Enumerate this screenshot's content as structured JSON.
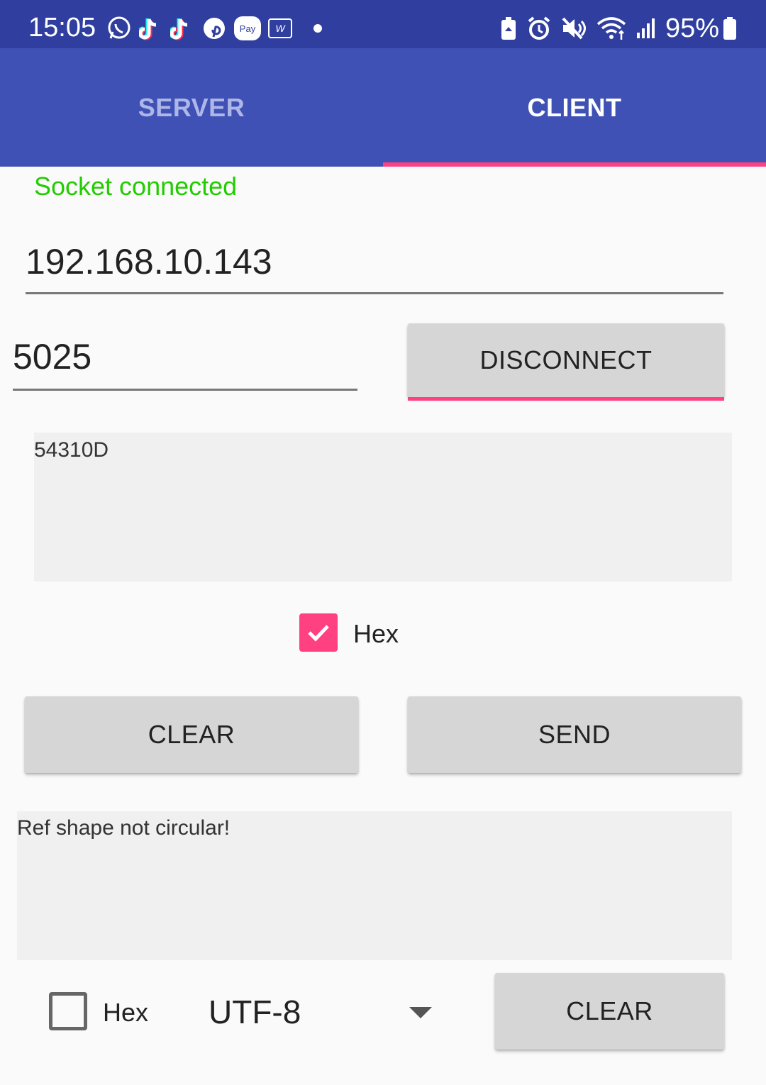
{
  "status_bar": {
    "time": "15:05",
    "battery": "95%",
    "left_icons": [
      "whatsapp-icon",
      "tiktok-icon",
      "tiktok-icon",
      "pinterest-icon",
      "pay-icon",
      "w-app-icon",
      "dot-icon"
    ],
    "pay_label": "Pay",
    "w_label": "W",
    "right_icons": [
      "battery-saver-icon",
      "alarm-icon",
      "mute-icon",
      "wifi-icon",
      "signal-icon",
      "battery-icon"
    ]
  },
  "tabs": [
    {
      "label": "SERVER",
      "active": false
    },
    {
      "label": "CLIENT",
      "active": true
    }
  ],
  "connection": {
    "status": "Socket connected",
    "status_color": "#22cc00",
    "ip": "192.168.10.143",
    "port": "5025",
    "disconnect_label": "DISCONNECT"
  },
  "send": {
    "text": "54310D",
    "hex_label": "Hex",
    "hex_checked": true,
    "clear_label": "CLEAR",
    "send_label": "SEND"
  },
  "receive": {
    "text": "Ref shape not circular!",
    "hex_label": "Hex",
    "hex_checked": false,
    "encoding": "UTF-8",
    "clear_label": "CLEAR"
  },
  "colors": {
    "status_bar": "#303f9f",
    "app_bar": "#3f51b5",
    "accent": "#ff4081"
  }
}
